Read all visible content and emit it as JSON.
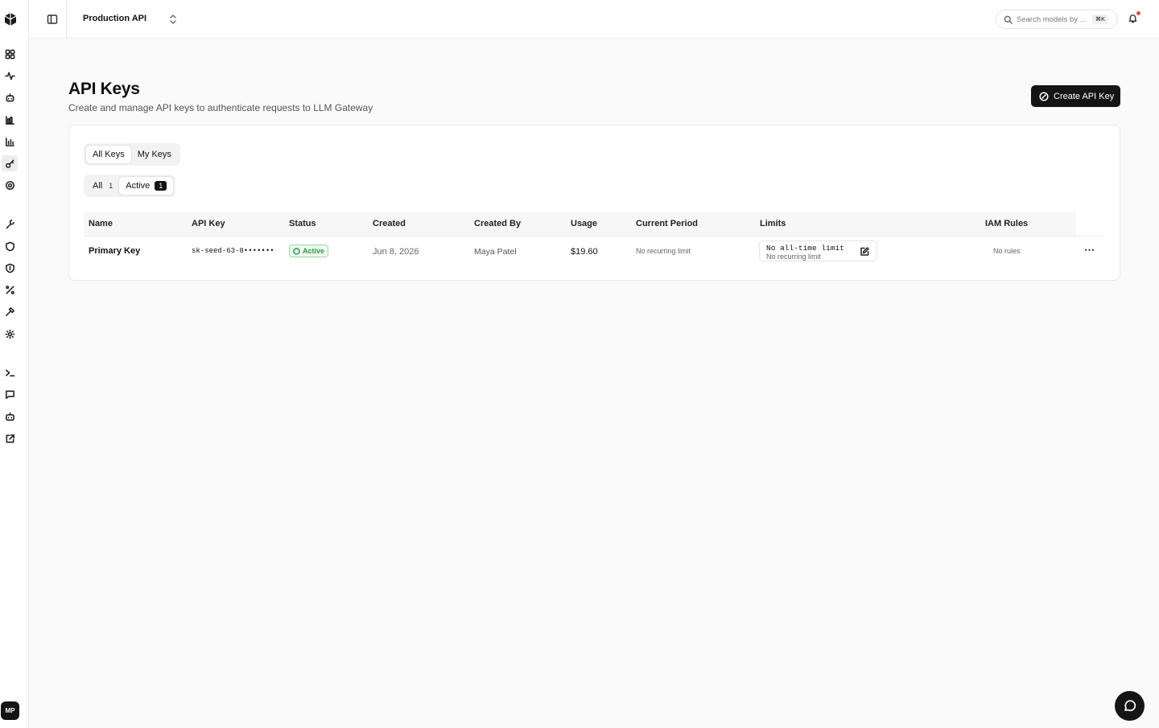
{
  "sidebar": {
    "avatar_initials": "MP",
    "icons": [
      "dashboard-icon",
      "activity-icon",
      "bot-icon",
      "bar-chart-icon",
      "chart-icon",
      "key-icon",
      "settings-icon",
      "wrench-icon",
      "shield-icon",
      "shield-check-icon",
      "percent-icon",
      "hammer-icon",
      "gear-icon",
      "terminal-icon",
      "message-icon",
      "chat-bot-icon",
      "external-link-icon"
    ],
    "active_icon": "key-icon"
  },
  "topbar": {
    "project_name": "Production API",
    "search_placeholder": "Search models by ...",
    "search_shortcut": "⌘K"
  },
  "header": {
    "title": "API Keys",
    "subtitle": "Create and manage API keys to authenticate requests to LLM Gateway",
    "create_button": "Create API Key"
  },
  "filters": {
    "scope_tabs": [
      {
        "label": "All Keys",
        "selected": true
      },
      {
        "label": "My Keys",
        "selected": false
      }
    ],
    "status_tabs": [
      {
        "label": "All",
        "count": "1",
        "selected": false
      },
      {
        "label": "Active",
        "count": "1",
        "selected": true
      }
    ]
  },
  "table": {
    "columns": [
      "Name",
      "API Key",
      "Status",
      "Created",
      "Created By",
      "Usage",
      "Current Period",
      "Limits",
      "IAM Rules"
    ],
    "rows": [
      {
        "name": "Primary Key",
        "api_key": "sk-seed-63-8•••••••",
        "status": "Active",
        "created": "Jun 8, 2026",
        "created_by": "Maya Patel",
        "usage": "$19.60",
        "current_period": "No recurring limit",
        "limits_main": "No all-time limit",
        "limits_sub": "No recurring limit",
        "iam_rules": "No rules"
      }
    ]
  },
  "colors": {
    "primary": "#151515",
    "active_green": "#2f9a45",
    "notification_dot": "#e5484d"
  }
}
